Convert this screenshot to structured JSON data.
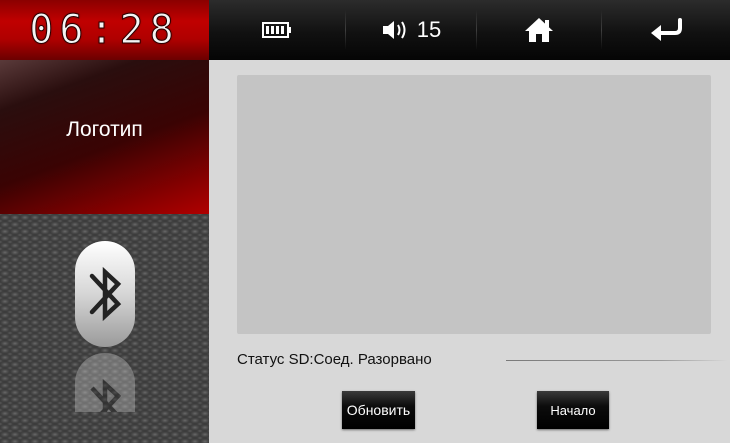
{
  "topbar": {
    "time": "06:28",
    "volume_level": "15",
    "battery_icon": "battery-full-icon",
    "volume_icon": "speaker-icon",
    "home_icon": "home-icon",
    "back_icon": "return-arrow-icon"
  },
  "sidebar": {
    "logo_label": "Логотип",
    "bluetooth_icon": "bluetooth-icon"
  },
  "main": {
    "status_text": "Статус SD:Соед. Разорвано",
    "refresh_label": "Обновить",
    "start_label": "Начало"
  },
  "colors": {
    "accent_red": "#c00000",
    "topbar_black": "#111111",
    "preview_gray": "#c4c4c4",
    "background_gray": "#d8d8d8"
  }
}
